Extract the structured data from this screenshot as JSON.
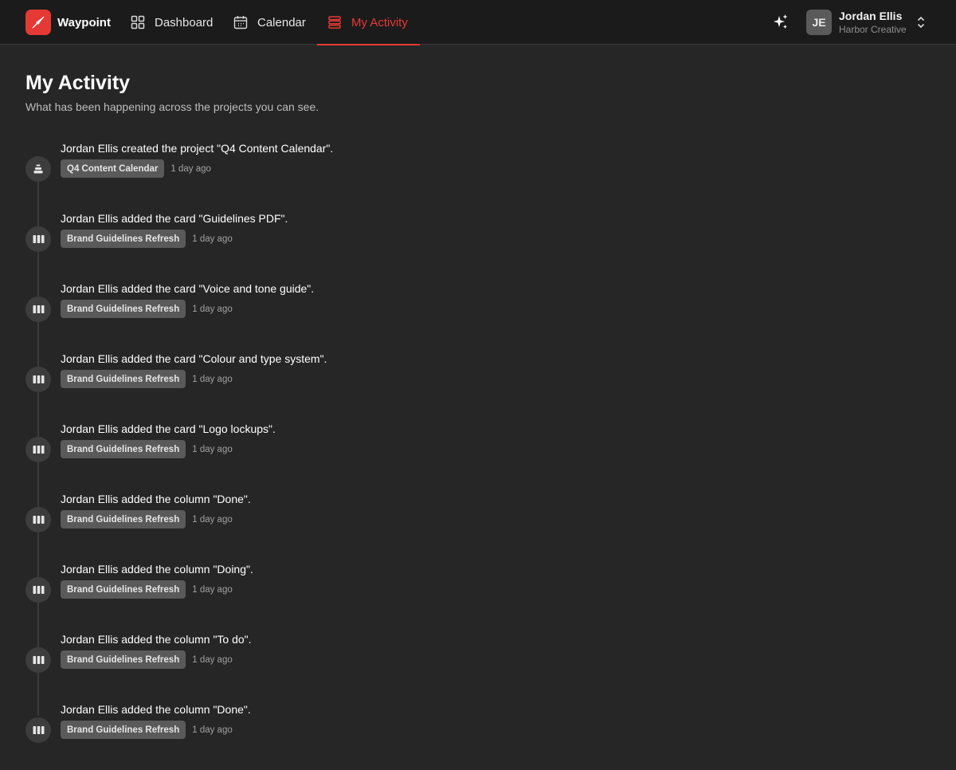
{
  "app": {
    "brand_name": "Waypoint",
    "brand_color": "#e53935"
  },
  "nav": {
    "items": [
      {
        "label": "Dashboard",
        "icon": "grid-icon"
      },
      {
        "label": "Calendar",
        "icon": "calendar-icon"
      },
      {
        "label": "My Activity",
        "icon": "activity-list-icon",
        "active": true
      }
    ]
  },
  "account": {
    "initials": "JE",
    "name": "Jordan Ellis",
    "org": "Harbor Creative"
  },
  "page": {
    "title": "My Activity",
    "subtitle": "What has been happening across the projects you can see."
  },
  "activities": [
    {
      "text": "Jordan Ellis created the project \"Q4 Content Calendar\".",
      "project": "Q4 Content Calendar",
      "time": "1 day ago",
      "icon": "project-stack-icon"
    },
    {
      "text": "Jordan Ellis added the card \"Guidelines PDF\".",
      "project": "Brand Guidelines Refresh",
      "time": "1 day ago",
      "icon": "board-columns-icon"
    },
    {
      "text": "Jordan Ellis added the card \"Voice and tone guide\".",
      "project": "Brand Guidelines Refresh",
      "time": "1 day ago",
      "icon": "board-columns-icon"
    },
    {
      "text": "Jordan Ellis added the card \"Colour and type system\".",
      "project": "Brand Guidelines Refresh",
      "time": "1 day ago",
      "icon": "board-columns-icon"
    },
    {
      "text": "Jordan Ellis added the card \"Logo lockups\".",
      "project": "Brand Guidelines Refresh",
      "time": "1 day ago",
      "icon": "board-columns-icon"
    },
    {
      "text": "Jordan Ellis added the column \"Done\".",
      "project": "Brand Guidelines Refresh",
      "time": "1 day ago",
      "icon": "board-columns-icon"
    },
    {
      "text": "Jordan Ellis added the column \"Doing\".",
      "project": "Brand Guidelines Refresh",
      "time": "1 day ago",
      "icon": "board-columns-icon"
    },
    {
      "text": "Jordan Ellis added the column \"To do\".",
      "project": "Brand Guidelines Refresh",
      "time": "1 day ago",
      "icon": "board-columns-icon"
    },
    {
      "text": "Jordan Ellis added the column \"Done\".",
      "project": "Brand Guidelines Refresh",
      "time": "1 day ago",
      "icon": "board-columns-icon"
    }
  ]
}
